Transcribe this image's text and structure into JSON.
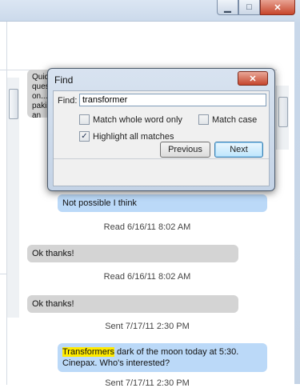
{
  "window": {
    "caption_buttons": {
      "minimize": "▁",
      "maximize": "□",
      "close": "✕"
    }
  },
  "messages": [
    {
      "kind": "bubble-gray",
      "text": "Quick question... pakistan from? Posib"
    },
    {
      "kind": "bubble-blue",
      "text": "Not possible I think"
    },
    {
      "kind": "stamp",
      "text": "Read 6/16/11 8:02 AM"
    },
    {
      "kind": "bubble-gray",
      "text": "Ok thanks!"
    },
    {
      "kind": "stamp",
      "text": "Read 6/16/11 8:02 AM"
    },
    {
      "kind": "bubble-gray",
      "text": "Ok thanks!"
    },
    {
      "kind": "stamp",
      "text": "Sent 7/17/11 2:30 PM"
    },
    {
      "kind": "bubble-blue-hl",
      "highlight": "Transformers",
      "rest": " dark of the moon today at 5:30. Cinepax. Who's interested?"
    },
    {
      "kind": "stamp",
      "text": "Sent 7/17/11 2:30 PM"
    }
  ],
  "find_dialog": {
    "title": "Find",
    "close_label": "✕",
    "find_label": "Find:",
    "query": "transformer",
    "options": {
      "match_whole_word": {
        "label": "Match whole word only",
        "checked": false
      },
      "match_case": {
        "label": "Match case",
        "checked": false
      },
      "highlight_all": {
        "label": "Highlight all matches",
        "checked": true,
        "mark": "✓"
      }
    },
    "previous_label": "Previous",
    "next_label": "Next"
  }
}
